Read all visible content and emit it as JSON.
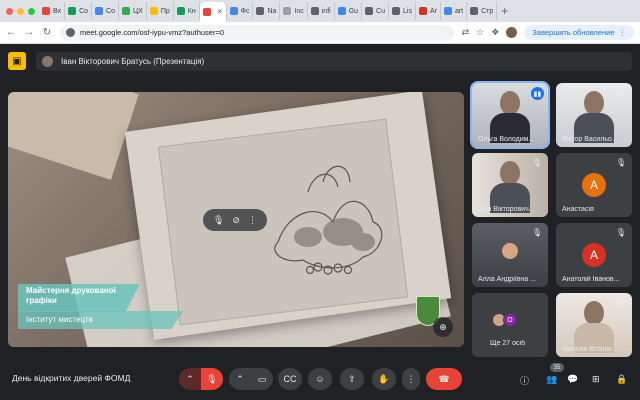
{
  "browser": {
    "tabs": [
      {
        "label": "Вх",
        "color": "#ea4335"
      },
      {
        "label": "Co",
        "color": "#0f9d58"
      },
      {
        "label": "Co",
        "color": "#4285f4"
      },
      {
        "label": "ЦХ",
        "color": "#34a853"
      },
      {
        "label": "Пр",
        "color": "#fbbc04"
      },
      {
        "label": "Кн",
        "color": "#0f9d58"
      },
      {
        "label": "",
        "color": "#ea4335",
        "active": true
      },
      {
        "label": "Фс",
        "color": "#4285f4"
      },
      {
        "label": "Na",
        "color": "#5f6368"
      },
      {
        "label": "Inc",
        "color": "#9aa0a6"
      },
      {
        "label": "infi",
        "color": "#5f6368"
      },
      {
        "label": "Gu",
        "color": "#4285f4"
      },
      {
        "label": "Cu",
        "color": "#5f6368"
      },
      {
        "label": "Lis",
        "color": "#5f6368"
      },
      {
        "label": "Ar",
        "color": "#d93025"
      },
      {
        "label": "art",
        "color": "#4285f4"
      },
      {
        "label": "Стр",
        "color": "#5f6368"
      }
    ],
    "url": "meet.google.com/osf-iypu-vmz?authuser=0",
    "update_button": "Завершить обновление"
  },
  "presenter": {
    "name": "Іван Вікторович Братусь (Презентація)"
  },
  "presentation": {
    "banner_title": "Майстерня друкованої графіки",
    "banner_subtitle": "Інститут мистецтв"
  },
  "participants": [
    {
      "name": "Ольга Володим...",
      "type": "video",
      "speaking": true
    },
    {
      "name": "Віктор Васильо...",
      "type": "video"
    },
    {
      "name": "Іван Вікторович...",
      "type": "video"
    },
    {
      "name": "Анастасія",
      "type": "avatar",
      "initial": "A",
      "color": "#e8710a"
    },
    {
      "name": "Алла Андріївна ...",
      "type": "photo"
    },
    {
      "name": "Анатолій Іванов...",
      "type": "avatar",
      "initial": "A",
      "color": "#d93025"
    },
    {
      "name": "Ще 27 осіб",
      "type": "more",
      "initial": "O",
      "color": "#8e24aa"
    },
    {
      "name": "Наталія Віталів...",
      "type": "video"
    }
  ],
  "bottom": {
    "meeting_name": "День відкритих дверей ФОМД",
    "participant_count": "35"
  },
  "icons": {
    "present": "present-to-all-icon",
    "mic_off": "mic-off-icon",
    "camera": "videocam-icon",
    "captions": "closed-caption-icon",
    "emoji": "emoji-icon",
    "share": "present-screen-icon",
    "hand": "raise-hand-icon",
    "more": "more-vert-icon",
    "end_call": "call-end-icon",
    "info": "info-icon",
    "people": "people-icon",
    "activities": "activities-icon",
    "lock": "host-controls-icon"
  }
}
